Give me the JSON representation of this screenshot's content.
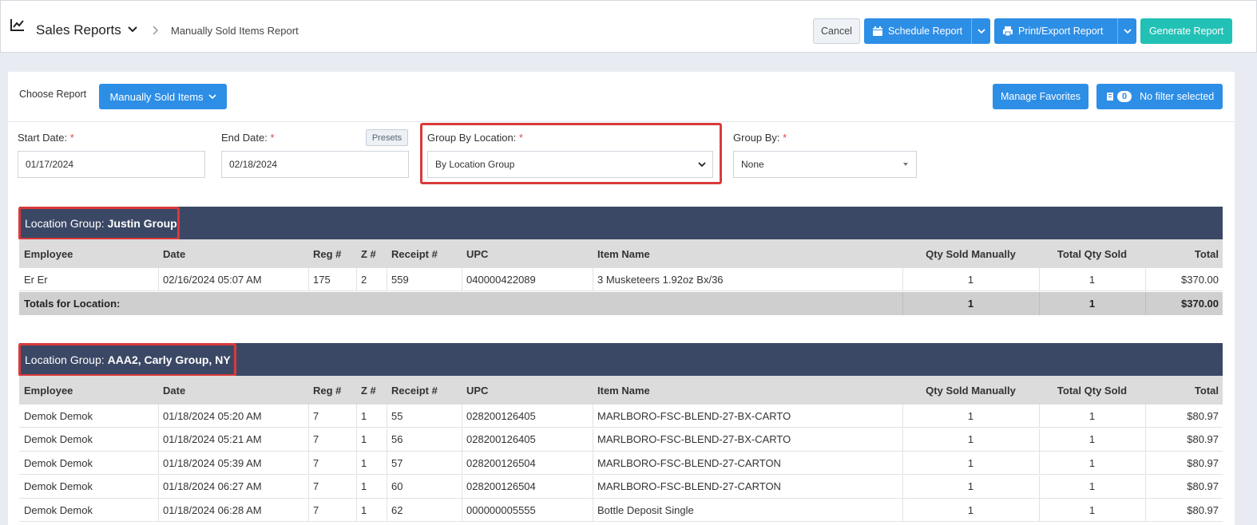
{
  "header": {
    "title": "Sales Reports",
    "breadcrumb": "Manually Sold Items Report",
    "cancel_label": "Cancel",
    "schedule_label": "Schedule Report",
    "print_label": "Print/Export Report",
    "generate_label": "Generate Report"
  },
  "controls": {
    "choose_label": "Choose Report",
    "choose_value": "Manually Sold Items",
    "favorites_label": "Manage Favorites",
    "filter_count": "0",
    "filter_label": "No filter selected"
  },
  "filters": {
    "start_label": "Start Date:",
    "start_value": "01/17/2024",
    "end_label": "End Date:",
    "end_value": "02/18/2024",
    "presets_label": "Presets",
    "group_location_label": "Group By Location:",
    "group_location_value": "By Location Group",
    "group_by_label": "Group By:",
    "group_by_value": "None",
    "required_mark": "*"
  },
  "columns": [
    "Employee",
    "Date",
    "Reg #",
    "Z #",
    "Receipt #",
    "UPC",
    "Item Name",
    "Qty Sold Manually",
    "Total Qty Sold",
    "Total"
  ],
  "groups": [
    {
      "prefix": "Location Group:",
      "name": "Justin Group",
      "rows": [
        [
          "Er Er",
          "02/16/2024 05:07 AM",
          "175",
          "2",
          "559",
          "040000422089",
          "3 Musketeers 1.92oz Bx/36",
          "1",
          "1",
          "$370.00"
        ]
      ],
      "totals": {
        "label": "Totals for Location:",
        "qty_manual": "1",
        "qty_total": "1",
        "total": "$370.00"
      }
    },
    {
      "prefix": "Location Group:",
      "name": "AAA2, Carly Group, NY",
      "rows": [
        [
          "Demok Demok",
          "01/18/2024 05:20 AM",
          "7",
          "1",
          "55",
          "028200126405",
          "MARLBORO-FSC-BLEND-27-BX-CARTO",
          "1",
          "1",
          "$80.97"
        ],
        [
          "Demok Demok",
          "01/18/2024 05:21 AM",
          "7",
          "1",
          "56",
          "028200126405",
          "MARLBORO-FSC-BLEND-27-BX-CARTO",
          "1",
          "1",
          "$80.97"
        ],
        [
          "Demok Demok",
          "01/18/2024 05:39 AM",
          "7",
          "1",
          "57",
          "028200126504",
          "MARLBORO-FSC-BLEND-27-CARTON",
          "1",
          "1",
          "$80.97"
        ],
        [
          "Demok Demok",
          "01/18/2024 06:27 AM",
          "7",
          "1",
          "60",
          "028200126504",
          "MARLBORO-FSC-BLEND-27-CARTON",
          "1",
          "1",
          "$80.97"
        ],
        [
          "Demok Demok",
          "01/18/2024 06:28 AM",
          "7",
          "1",
          "62",
          "000000005555",
          "Bottle Deposit Single",
          "1",
          "1",
          "$80.97"
        ]
      ]
    }
  ],
  "colors": {
    "accent": "#2d8ee6",
    "teal": "#22c1b5",
    "group_header": "#3b4865",
    "highlight": "#d93a3a"
  }
}
